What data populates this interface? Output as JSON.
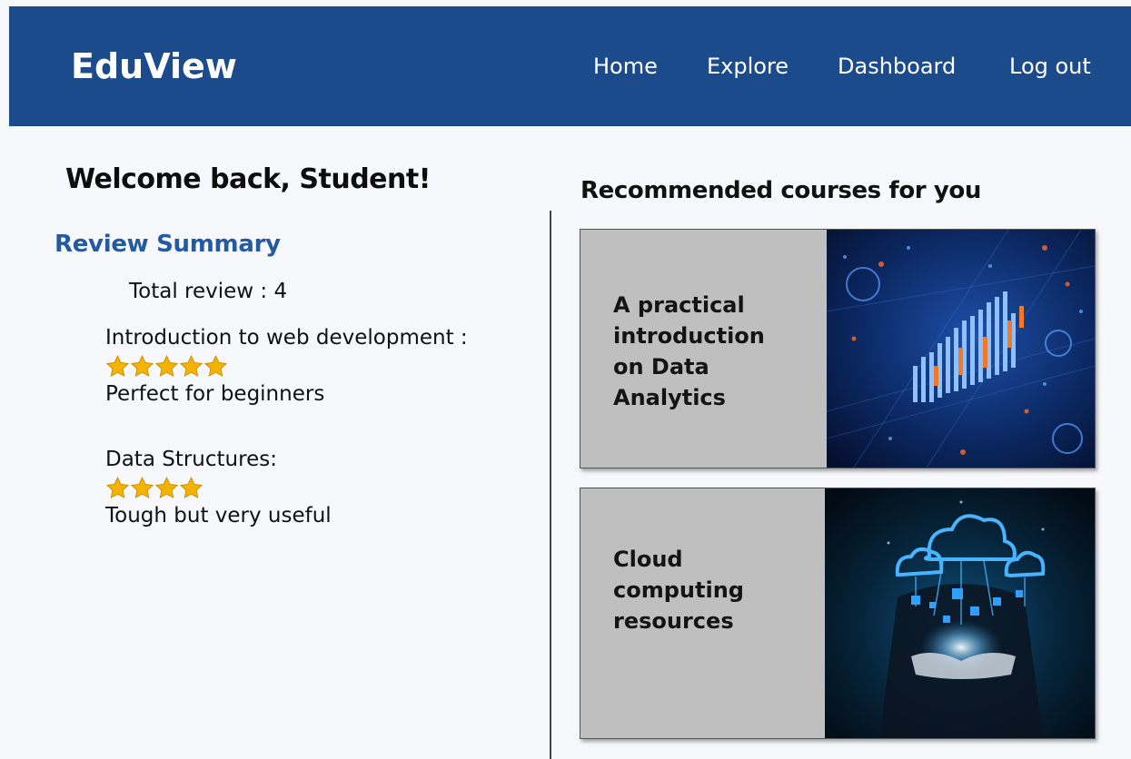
{
  "header": {
    "brand": "EduView",
    "nav": [
      "Home",
      "Explore",
      "Dashboard",
      "Log out"
    ]
  },
  "welcome": "Welcome back, Student!",
  "review_summary": {
    "title": "Review Summary",
    "total": "Total review : 4",
    "items": [
      {
        "course": "Introduction to web development :",
        "stars": 5,
        "comment": "Perfect for beginners"
      },
      {
        "course": "Data Structures:",
        "stars": 4,
        "comment": "Tough but very useful"
      }
    ]
  },
  "recommended": {
    "title": "Recommended courses for you",
    "courses": [
      {
        "title_lines": [
          "A practical",
          "introduction",
          "on Data",
          "Analytics"
        ],
        "image": "data-analytics-chart-image"
      },
      {
        "title_lines": [
          "Cloud",
          "computing",
          "resources"
        ],
        "image": "cloud-computing-hands-image"
      }
    ]
  },
  "colors": {
    "navbar": "#1c4b8c",
    "review_title": "#245aa0",
    "card_bg": "#bfbfbf",
    "star": "#f5b301"
  }
}
